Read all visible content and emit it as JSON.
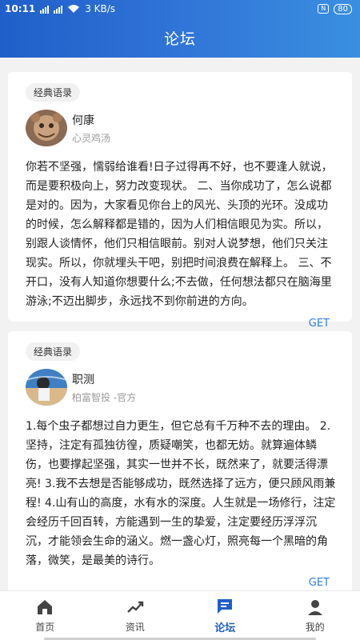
{
  "status": {
    "time": "10:11",
    "network": "3 KB/s",
    "battery": "80"
  },
  "header": {
    "title": "论坛"
  },
  "posts": [
    {
      "tag": "经典语录",
      "author": "何康",
      "subtitle": "心灵鸡汤",
      "text": "你若不坚强，懦弱给谁看!日子过得再不好，也不要逢人就说，而是要积极向上，努力改变现状。 二、当你成功了，怎么说都是对的。因为，大家看见你台上的风光、头顶的光环。没成功的时候，怎么解释都是错的，因为人们相信眼见为实。所以，别跟人谈情怀，他们只相信眼前。别对人说梦想，他们只关注现实。所以，你就埋头干吧，别把时间浪费在解释上。 三、不开口，没有人知道你想要什么;不去做，任何想法都只在脑海里游泳;不迈出脚步，永远找不到你前进的方向。",
      "action": "GET"
    },
    {
      "tag": "经典语录",
      "author": "职测",
      "subtitle": "柏富智投 -官方",
      "text": "1.每个虫子都想过自力更生，但它总有千万种不去的理由。 2.坚持，注定有孤独彷徨，质疑嘲笑，也都无妨。就算遍体鳞伤，也要撑起坚强，其实一世并不长，既然来了，就要活得漂亮! 3.我不去想是否能够成功，既然选择了远方，便只顾风雨兼程! 4.山有山的高度，水有水的深度。人生就是一场修行，注定会经历千回百转，方能遇到一生的挚爱，注定要经历浮浮沉沉，才能领会生命的涵义。燃一盏心灯，照亮每一个黑暗的角落，微笑，是最美的诗行。",
      "action": "GET"
    }
  ],
  "tabs": [
    {
      "label": "首页",
      "icon": "home-icon"
    },
    {
      "label": "资讯",
      "icon": "trend-icon"
    },
    {
      "label": "论坛",
      "icon": "chat-icon",
      "active": true
    },
    {
      "label": "我的",
      "icon": "user-icon"
    }
  ],
  "colors": {
    "accent": "#1f5fc9",
    "get": "#2f7de0"
  }
}
